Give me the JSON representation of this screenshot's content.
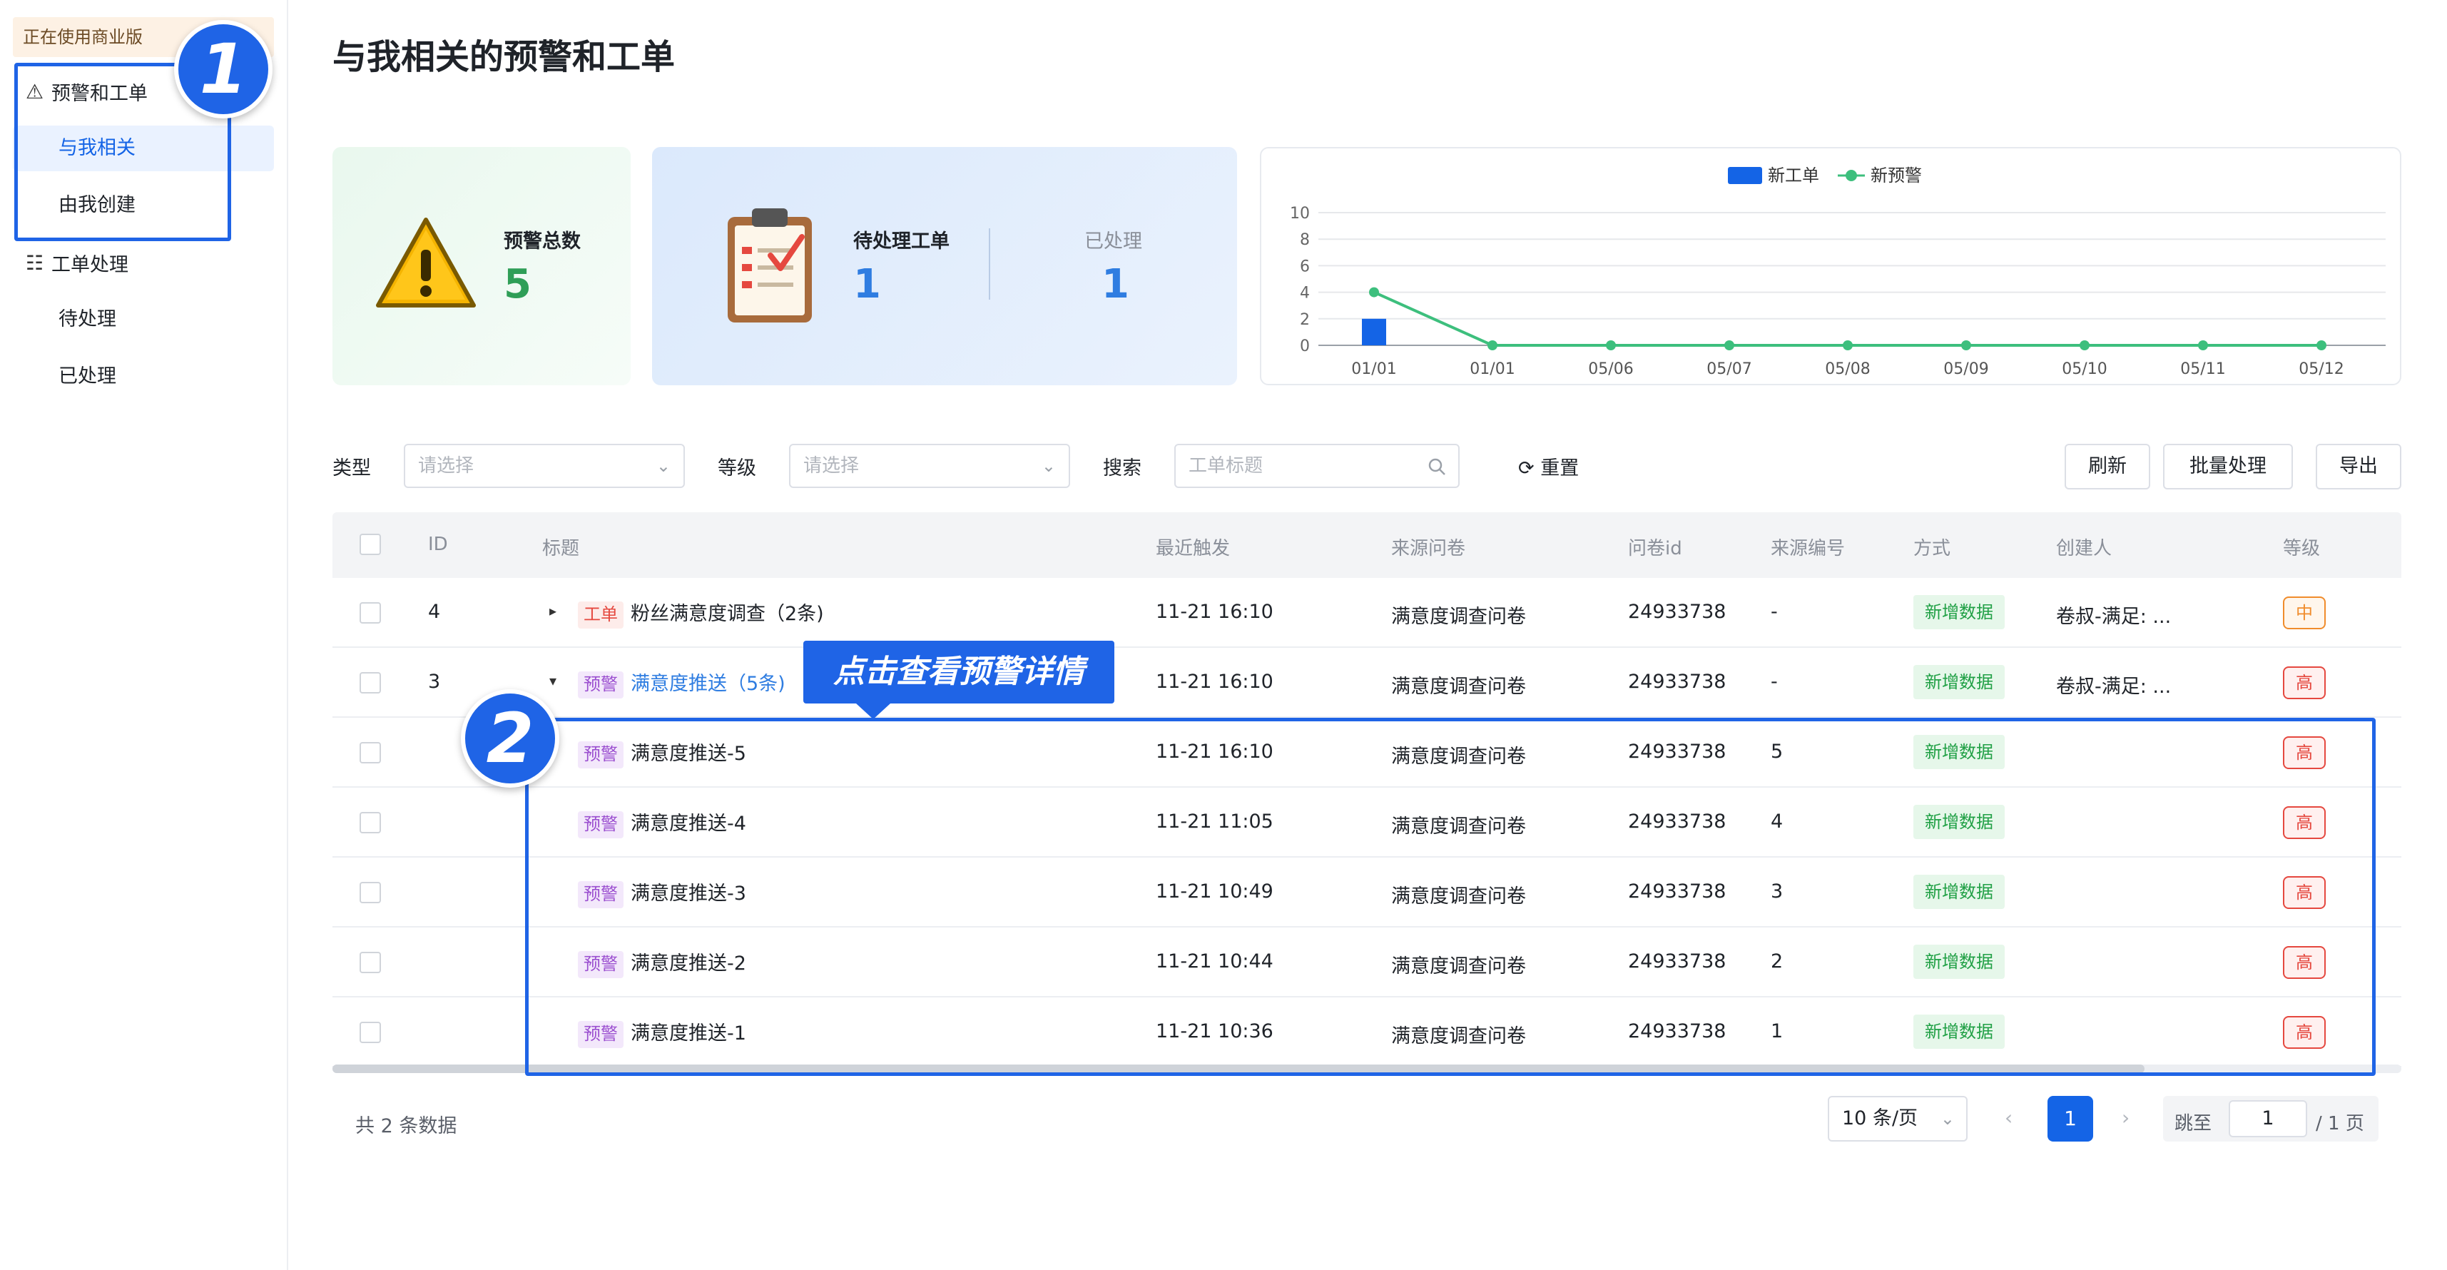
{
  "sidebar": {
    "edition": "正在使用商业版",
    "groups": [
      {
        "label": "预警和工单",
        "icon": "warning-triangle-icon",
        "items": [
          {
            "label": "与我相关",
            "active": true
          },
          {
            "label": "由我创建"
          }
        ]
      },
      {
        "label": "工单处理",
        "icon": "task-list-icon",
        "items": [
          {
            "label": "待处理"
          },
          {
            "label": "已处理"
          }
        ]
      }
    ]
  },
  "annotations": {
    "badge1": "1",
    "badge2": "2",
    "callout": "点击查看预警详情"
  },
  "page": {
    "title": "与我相关的预警和工单"
  },
  "stats": {
    "alerts": {
      "label": "预警总数",
      "value": "5"
    },
    "pending": {
      "label": "待处理工单",
      "value": "1"
    },
    "processed": {
      "label": "已处理",
      "value": "1"
    }
  },
  "chart_data": {
    "type": "bar+line",
    "categories": [
      "01/01",
      "01/01",
      "05/06",
      "05/07",
      "05/08",
      "05/09",
      "05/10",
      "05/11",
      "05/12"
    ],
    "series": [
      {
        "name": "新工单",
        "type": "bar",
        "values": [
          2,
          0,
          0,
          0,
          0,
          0,
          0,
          0,
          0
        ],
        "color": "#1464e6"
      },
      {
        "name": "新预警",
        "type": "line",
        "values": [
          4,
          0,
          0,
          0,
          0,
          0,
          0,
          0,
          0
        ],
        "color": "#3dbf7d"
      }
    ],
    "yticks": [
      "0",
      "2",
      "4",
      "6",
      "8",
      "10"
    ],
    "ylim": [
      0,
      10
    ],
    "legend": "top-center",
    "grid": true
  },
  "filters": {
    "type_label": "类型",
    "type_placeholder": "请选择",
    "level_label": "等级",
    "level_placeholder": "请选择",
    "search_label": "搜索",
    "search_placeholder": "工单标题",
    "reset": "重置",
    "refresh": "刷新",
    "batch": "批量处理",
    "export": "导出"
  },
  "table": {
    "headers": {
      "id": "ID",
      "title": "标题",
      "last": "最近触发",
      "source": "来源问卷",
      "qid": "问卷id",
      "srcno": "来源编号",
      "method": "方式",
      "creator": "创建人",
      "level": "等级"
    },
    "rows": [
      {
        "id": "4",
        "tag": "工单",
        "title": "粉丝满意度调查（2条)",
        "last": "11-21 16:10",
        "source": "满意度调查问卷",
        "qid": "24933738",
        "srcno": "-",
        "method": "新增数据",
        "creator": "卷叔-满足: ...",
        "level": "中"
      },
      {
        "id": "3",
        "tag": "预警",
        "title": "满意度推送（5条)",
        "last": "11-21 16:10",
        "source": "满意度调查问卷",
        "qid": "24933738",
        "srcno": "-",
        "method": "新增数据",
        "creator": "卷叔-满足: ...",
        "level": "高"
      },
      {
        "tag": "预警",
        "title": "满意度推送-5",
        "last": "11-21 16:10",
        "source": "满意度调查问卷",
        "qid": "24933738",
        "srcno": "5",
        "method": "新增数据",
        "level": "高"
      },
      {
        "tag": "预警",
        "title": "满意度推送-4",
        "last": "11-21 11:05",
        "source": "满意度调查问卷",
        "qid": "24933738",
        "srcno": "4",
        "method": "新增数据",
        "level": "高"
      },
      {
        "tag": "预警",
        "title": "满意度推送-3",
        "last": "11-21 10:49",
        "source": "满意度调查问卷",
        "qid": "24933738",
        "srcno": "3",
        "method": "新增数据",
        "level": "高"
      },
      {
        "tag": "预警",
        "title": "满意度推送-2",
        "last": "11-21 10:44",
        "source": "满意度调查问卷",
        "qid": "24933738",
        "srcno": "2",
        "method": "新增数据",
        "level": "高"
      },
      {
        "tag": "预警",
        "title": "满意度推送-1",
        "last": "11-21 10:36",
        "source": "满意度调查问卷",
        "qid": "24933738",
        "srcno": "1",
        "method": "新增数据",
        "level": "高"
      }
    ]
  },
  "pagination": {
    "total": "共 2 条数据",
    "page_size": "10 条/页",
    "current": "1",
    "jump_label": "跳至",
    "jump_value": "1",
    "jump_suffix": "/ 1 页"
  }
}
